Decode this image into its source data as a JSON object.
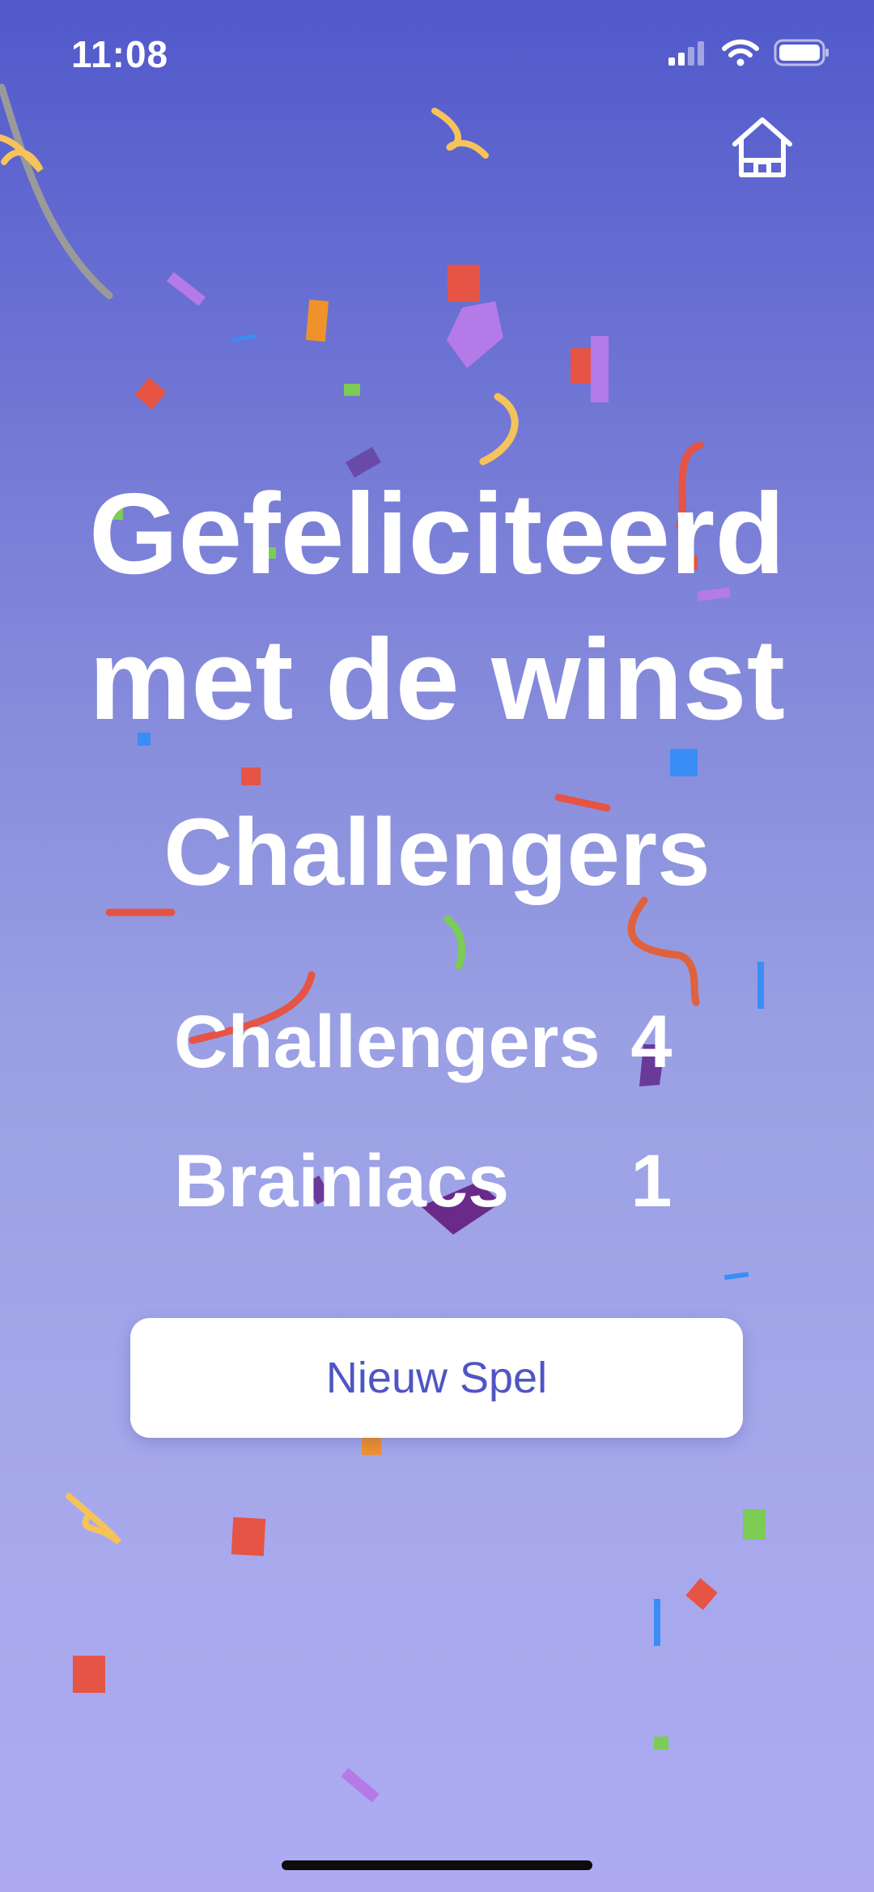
{
  "status_bar": {
    "time": "11:08"
  },
  "header": {
    "home_icon": "home-icon"
  },
  "main": {
    "title_line1": "Gefeliciteerd",
    "title_line2": "met de winst",
    "winner_name": "Challengers",
    "scores": [
      {
        "team": "Challengers",
        "score": "4"
      },
      {
        "team": "Brainiacs",
        "score": "1"
      }
    ],
    "new_game_label": "Nieuw Spel"
  },
  "colors": {
    "gradient_top": "#5159cb",
    "gradient_bottom": "#adaaf2",
    "button_text": "#4f55c4",
    "button_background": "#ffffff"
  }
}
